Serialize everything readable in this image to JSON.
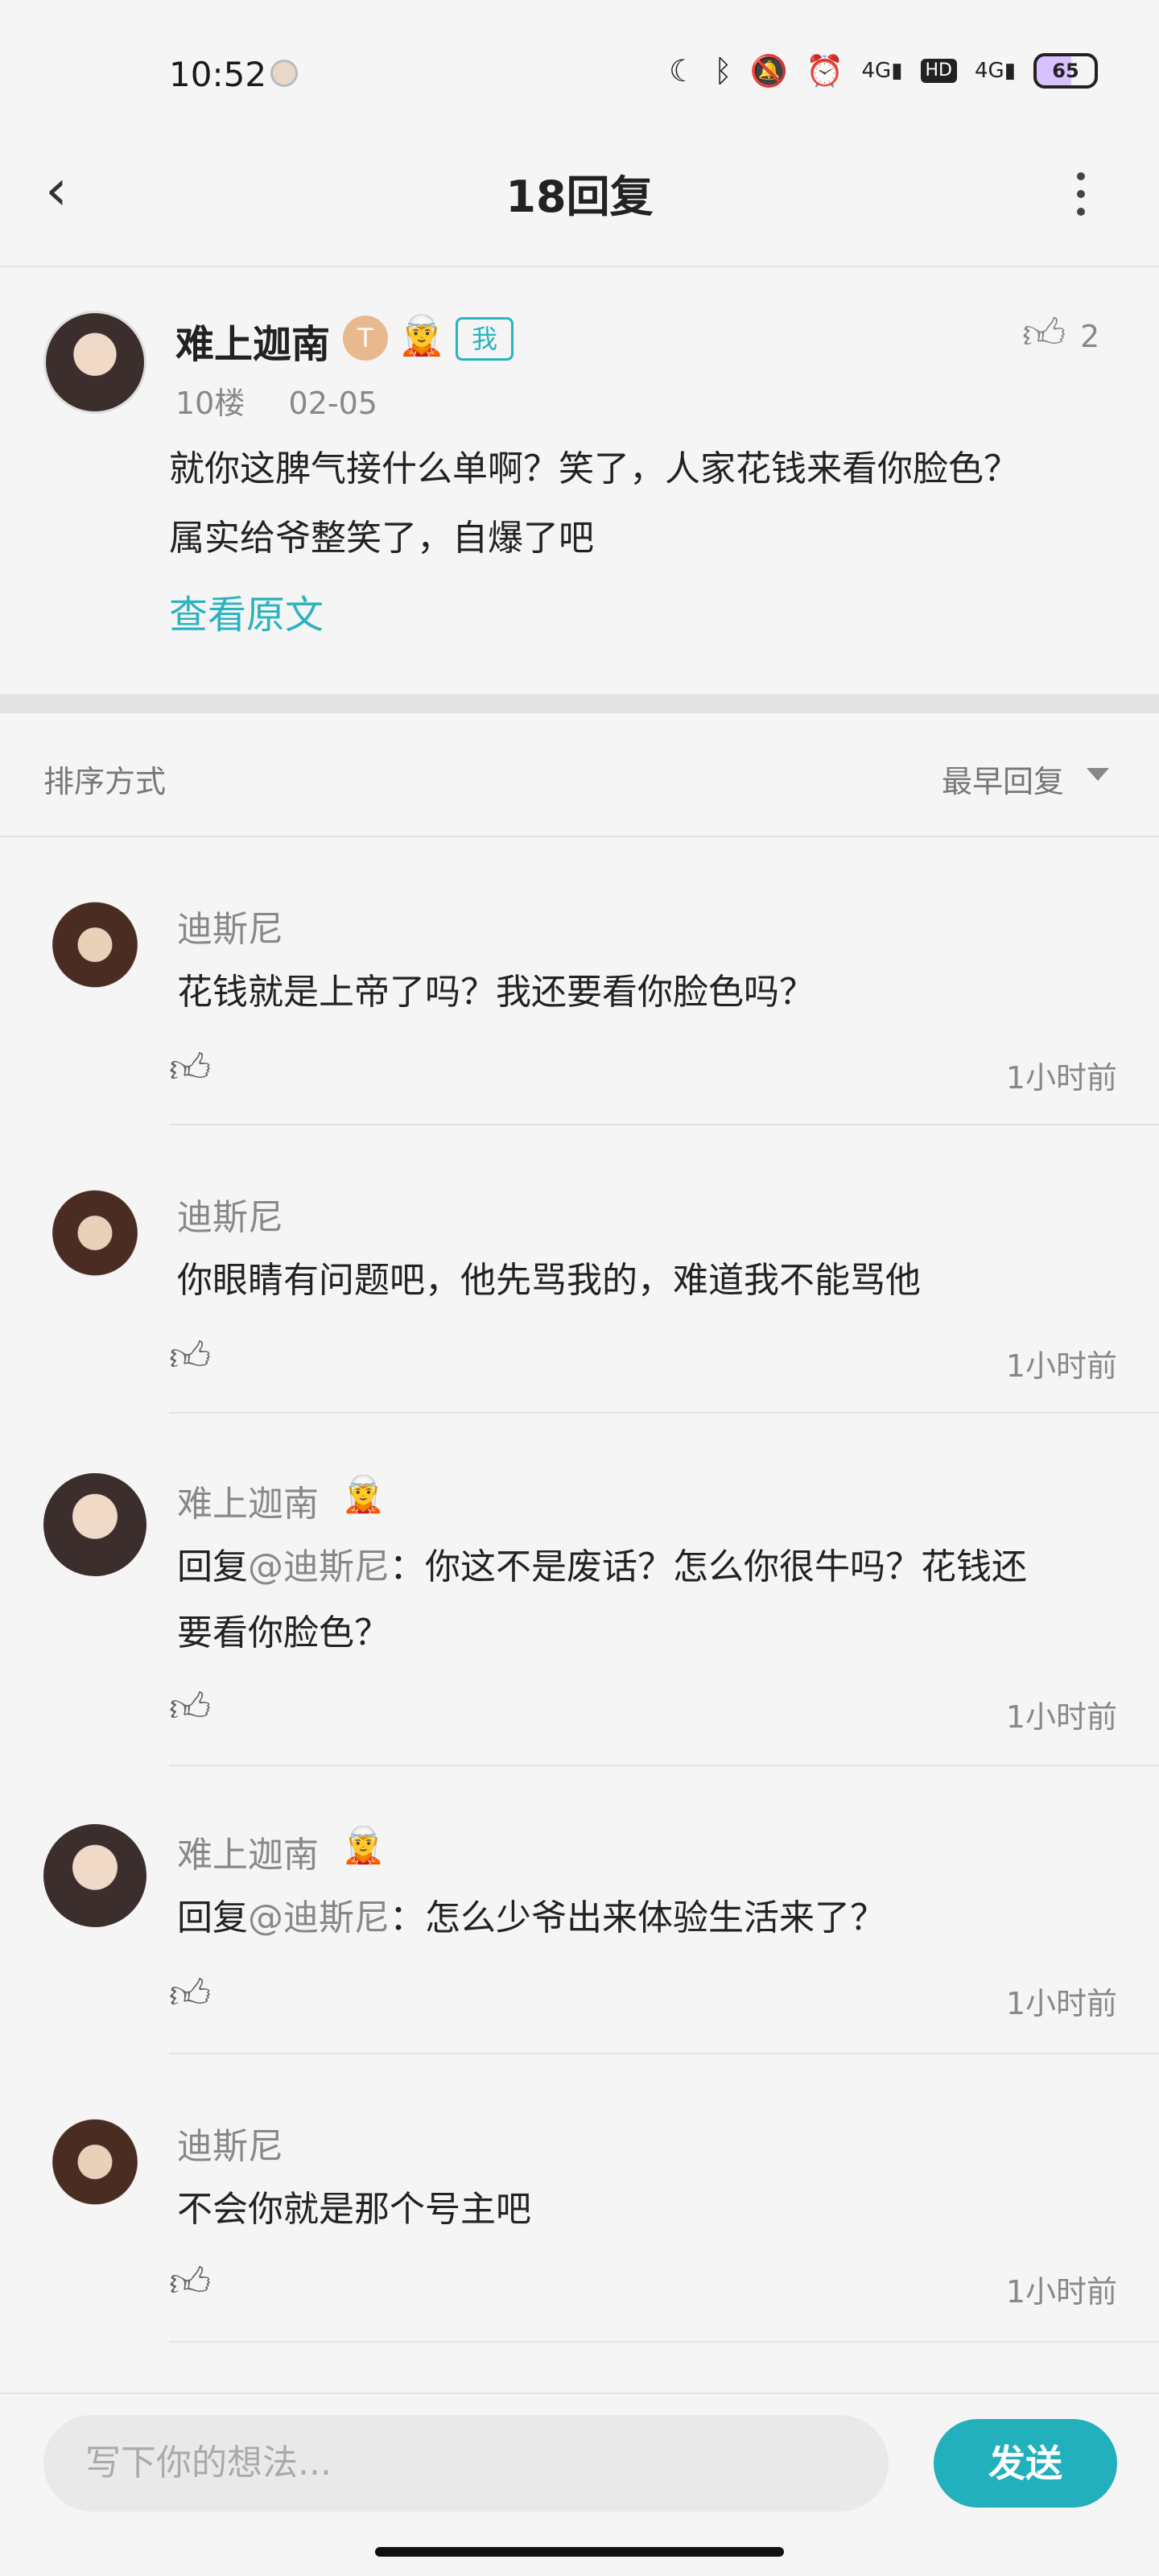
{
  "status_bar": {
    "time": "10:52",
    "battery": "65",
    "icons": [
      "moon-icon",
      "bluetooth-icon",
      "mute-icon",
      "alarm-icon",
      "signal-4g-icon",
      "hd-icon",
      "signal-4g-icon"
    ]
  },
  "header": {
    "title": "18回复"
  },
  "original_post": {
    "author": "难上迦南",
    "level_badge": "T",
    "me_badge": "我",
    "floor": "10楼",
    "date": "02-05",
    "text_line1": "就你这脾气接什么单啊？笑了，人家花钱来看你脸色？",
    "text_line2": "属实给爷整笑了，自爆了吧",
    "view_original": "查看原文",
    "like_count": "2"
  },
  "sort": {
    "label": "排序方式",
    "value": "最早回复"
  },
  "replies": [
    {
      "name": "迪斯尼",
      "text": "花钱就是上帝了吗？我还要看你脸色吗？",
      "time": "1小时前"
    },
    {
      "name": "迪斯尼",
      "text": "你眼睛有问题吧，他先骂我的，难道我不能骂他",
      "time": "1小时前"
    },
    {
      "name": "难上迦南",
      "reply_prefix": "回复",
      "mention": "@迪斯尼",
      "text_line1": "：你这不是废话？怎么你很牛吗？花钱还",
      "text_line2": "要看你脸色？",
      "time": "1小时前"
    },
    {
      "name": "难上迦南",
      "reply_prefix": "回复",
      "mention": "@迪斯尼",
      "text": "：怎么少爷出来体验生活来了？",
      "time": "1小时前"
    },
    {
      "name": "迪斯尼",
      "text": "不会你就是那个号主吧",
      "time": "1小时前"
    }
  ],
  "composer": {
    "placeholder": "写下你的想法...",
    "send_label": "发送"
  },
  "colors": {
    "accent": "#23b0bd",
    "background": "#f5f5f5"
  }
}
